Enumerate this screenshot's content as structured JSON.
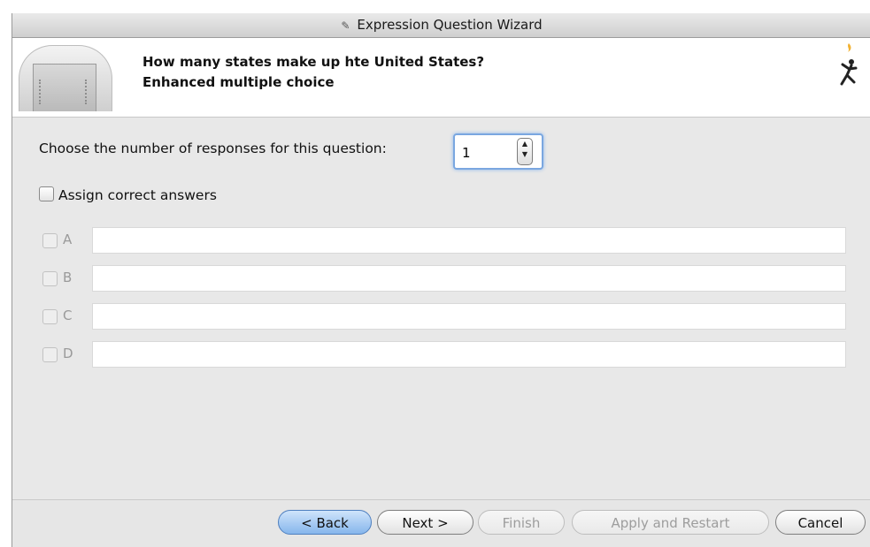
{
  "window": {
    "title": "Expression Question Wizard"
  },
  "header": {
    "question": "How many states make up hte United States?",
    "question_type": "Enhanced multiple choice"
  },
  "responses": {
    "label": "Choose the number of responses for this question:",
    "count_value": "1"
  },
  "assign": {
    "label": "Assign correct answers",
    "checked": false
  },
  "answers": [
    {
      "letter": "A",
      "value": ""
    },
    {
      "letter": "B",
      "value": ""
    },
    {
      "letter": "C",
      "value": ""
    },
    {
      "letter": "D",
      "value": ""
    }
  ],
  "buttons": {
    "back": "< Back",
    "next": "Next >",
    "finish": "Finish",
    "apply_restart": "Apply and Restart",
    "cancel": "Cancel"
  },
  "colors": {
    "primary_button": "#86b6ec",
    "focus_ring": "#7aa7e0"
  }
}
